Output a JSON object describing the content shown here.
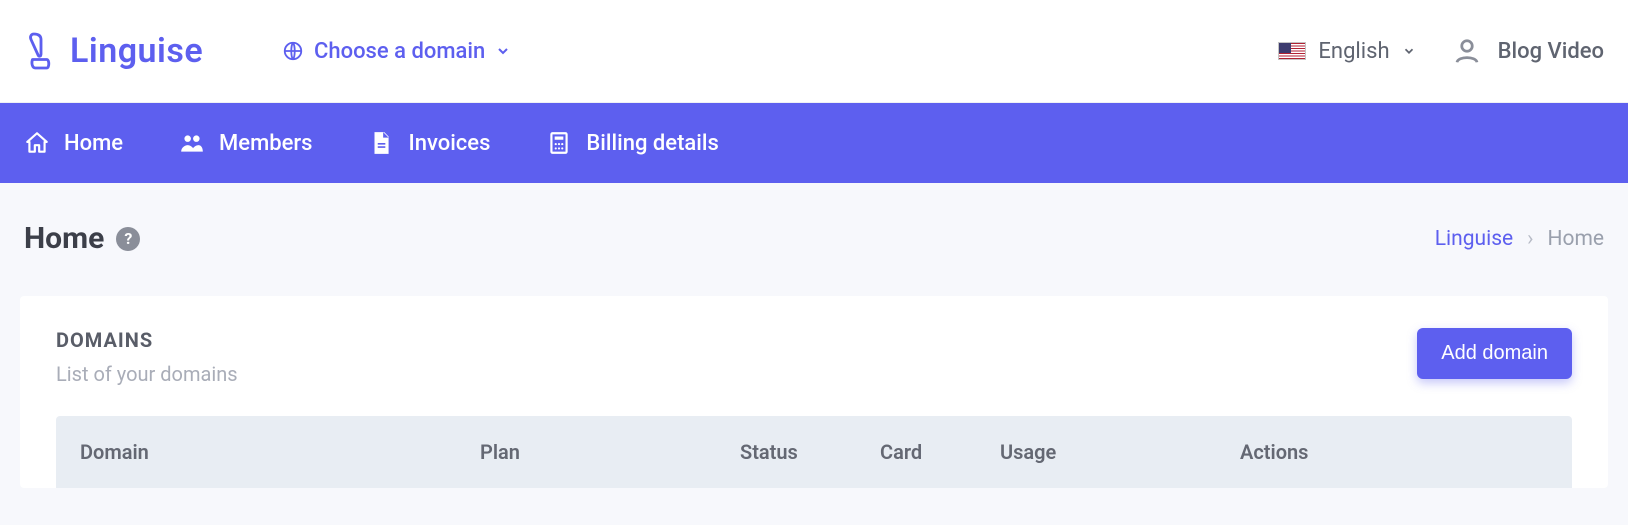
{
  "brand": {
    "name": "Linguise"
  },
  "topbar": {
    "domain_chooser_label": "Choose a domain",
    "language_label": "English",
    "user_label": "Blog Video"
  },
  "nav": {
    "home": "Home",
    "members": "Members",
    "invoices": "Invoices",
    "billing": "Billing details"
  },
  "page": {
    "title": "Home",
    "help_symbol": "?",
    "breadcrumb": {
      "root": "Linguise",
      "sep": "›",
      "current": "Home"
    }
  },
  "domains_card": {
    "title": "DOMAINS",
    "subtitle": "List of your domains",
    "add_button": "Add domain",
    "columns": {
      "domain": "Domain",
      "plan": "Plan",
      "status": "Status",
      "card": "Card",
      "usage": "Usage",
      "actions": "Actions"
    }
  }
}
